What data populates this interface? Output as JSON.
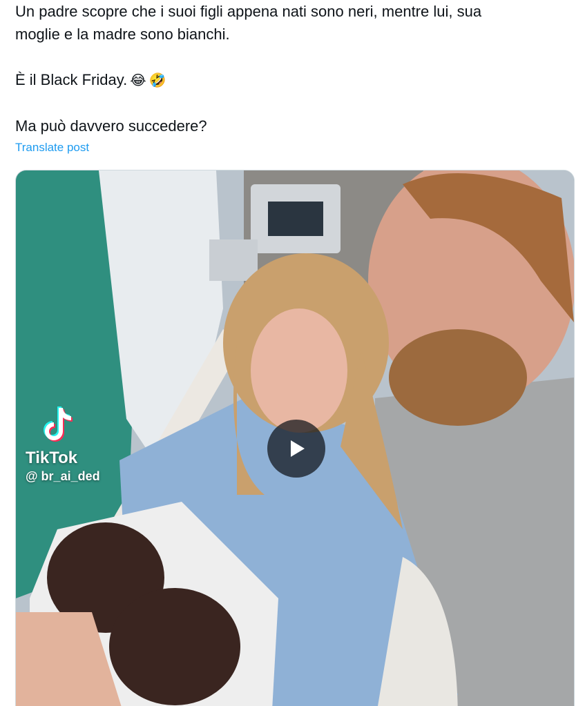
{
  "tweet": {
    "line1": "Un padre scopre che i suoi figli appena nati sono neri, mentre lui, sua",
    "line2": "moglie e la madre sono bianchi.",
    "line3": "È il Black Friday.",
    "emoji1": "😂",
    "emoji2": "🤣",
    "line4": "Ma può davvero succedere?"
  },
  "translate_label": "Translate post",
  "video": {
    "watermark_brand": "TikTok",
    "watermark_handle": "@ br_ai_ded",
    "play_icon": "play-icon"
  },
  "colors": {
    "link": "#1d9bf0",
    "text": "#0f1419",
    "border": "#cfd9de"
  }
}
